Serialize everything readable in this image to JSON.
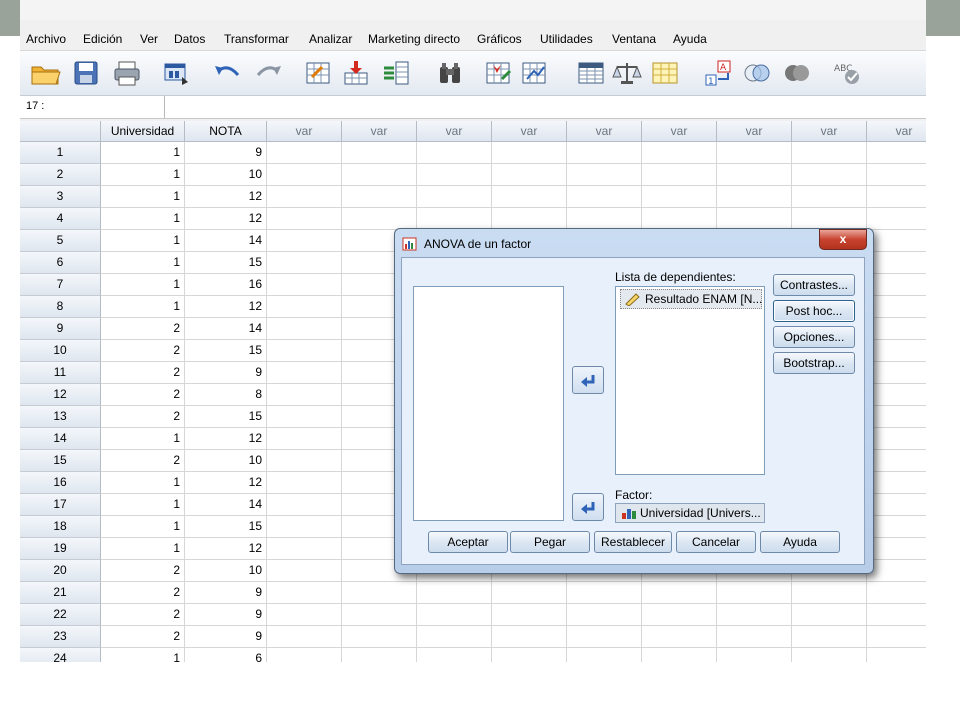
{
  "menu": [
    "Archivo",
    "Edición",
    "Ver",
    "Datos",
    "Transformar",
    "Analizar",
    "Marketing directo",
    "Gráficos",
    "Utilidades",
    "Ventana",
    "Ayuda"
  ],
  "cell_reference": "17 :",
  "columns": [
    "Universidad",
    "NOTA",
    "var",
    "var",
    "var",
    "var",
    "var",
    "var",
    "var",
    "var",
    "var"
  ],
  "rows": [
    {
      "n": "1",
      "u": "1",
      "nota": "9"
    },
    {
      "n": "2",
      "u": "1",
      "nota": "10"
    },
    {
      "n": "3",
      "u": "1",
      "nota": "12"
    },
    {
      "n": "4",
      "u": "1",
      "nota": "12"
    },
    {
      "n": "5",
      "u": "1",
      "nota": "14"
    },
    {
      "n": "6",
      "u": "1",
      "nota": "15"
    },
    {
      "n": "7",
      "u": "1",
      "nota": "16"
    },
    {
      "n": "8",
      "u": "1",
      "nota": "12"
    },
    {
      "n": "9",
      "u": "2",
      "nota": "14"
    },
    {
      "n": "10",
      "u": "2",
      "nota": "15"
    },
    {
      "n": "11",
      "u": "2",
      "nota": "9"
    },
    {
      "n": "12",
      "u": "2",
      "nota": "8"
    },
    {
      "n": "13",
      "u": "2",
      "nota": "15"
    },
    {
      "n": "14",
      "u": "1",
      "nota": "12"
    },
    {
      "n": "15",
      "u": "2",
      "nota": "10"
    },
    {
      "n": "16",
      "u": "1",
      "nota": "12"
    },
    {
      "n": "17",
      "u": "1",
      "nota": "14"
    },
    {
      "n": "18",
      "u": "1",
      "nota": "15"
    },
    {
      "n": "19",
      "u": "1",
      "nota": "12"
    },
    {
      "n": "20",
      "u": "2",
      "nota": "10"
    },
    {
      "n": "21",
      "u": "2",
      "nota": "9"
    },
    {
      "n": "22",
      "u": "2",
      "nota": "9"
    },
    {
      "n": "23",
      "u": "2",
      "nota": "9"
    },
    {
      "n": "24",
      "u": "1",
      "nota": "6"
    }
  ],
  "dialog": {
    "title": "ANOVA de un factor",
    "close": "x",
    "dependents_label": "Lista de dependientes:",
    "dependents": [
      "Resultado ENAM [N..."
    ],
    "factor_label": "Factor:",
    "factor_value": "Universidad [Univers...",
    "side_buttons": [
      "Contrastes...",
      "Post hoc...",
      "Opciones...",
      "Bootstrap..."
    ],
    "bottom_buttons": [
      "Aceptar",
      "Pegar",
      "Restablecer",
      "Cancelar",
      "Ayuda"
    ]
  },
  "toolbar_icons": [
    "open-folder-icon",
    "save-icon",
    "print-icon",
    "dialog-recall-icon",
    "undo-icon",
    "redo-icon",
    "goto-case-icon",
    "goto-variable-icon",
    "variables-icon",
    "find-icon",
    "insert-cases-icon",
    "insert-variable-icon",
    "split-file-icon",
    "weight-cases-icon",
    "select-cases-icon",
    "value-labels-icon",
    "use-sets-icon",
    "show-all-variables-icon",
    "spell-check-icon"
  ],
  "colors": {
    "topband": "#9aa39a",
    "dialog_frame": "#b7cde8",
    "dialog_body": "#e8f1fb",
    "close_button": "#c8432f"
  }
}
